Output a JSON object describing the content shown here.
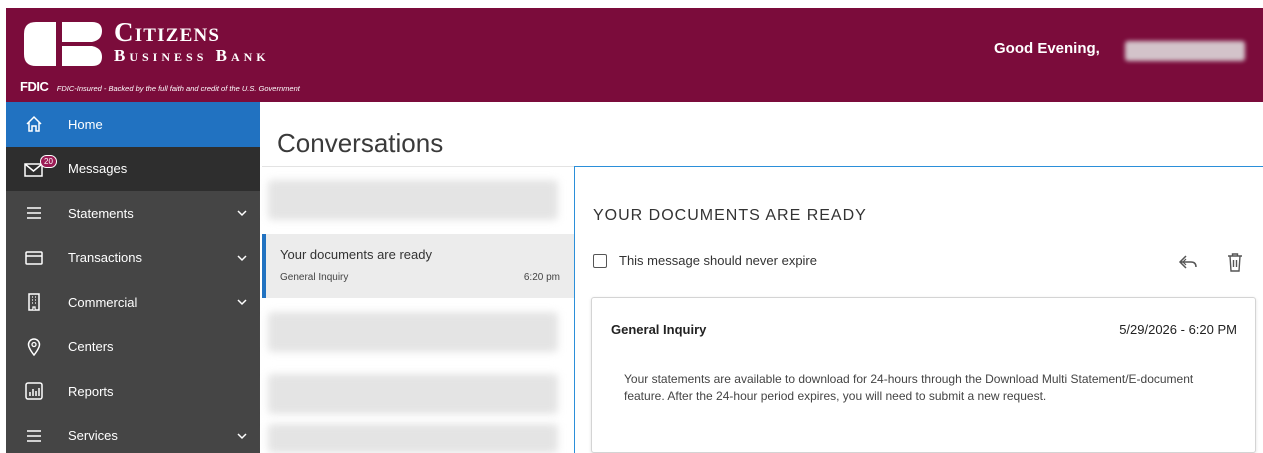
{
  "header": {
    "logo": {
      "line1": "Citizens",
      "line2": "Business Bank"
    },
    "fdic": {
      "logo": "FDIC",
      "text": "FDIC-Insured - Backed by the full faith and credit of the U.S. Government"
    },
    "greeting": "Good Evening,",
    "background_color": "#7b0c3b"
  },
  "sidebar": {
    "items": [
      {
        "label": "Home",
        "icon": "home-icon",
        "active": true
      },
      {
        "label": "Messages",
        "icon": "mail-icon",
        "badge": "20"
      },
      {
        "label": "Statements",
        "icon": "menu-icon",
        "expandable": true
      },
      {
        "label": "Transactions",
        "icon": "card-icon",
        "expandable": true
      },
      {
        "label": "Commercial",
        "icon": "building-icon",
        "expandable": true
      },
      {
        "label": "Centers",
        "icon": "location-pin-icon"
      },
      {
        "label": "Reports",
        "icon": "bar-chart-icon"
      },
      {
        "label": "Services",
        "icon": "menu-icon",
        "expandable": true
      }
    ],
    "active_color": "#2172c1"
  },
  "conversations": {
    "title": "Conversations",
    "selected": {
      "title": "Your documents are ready",
      "category": "General Inquiry",
      "time": "6:20 pm"
    }
  },
  "message": {
    "subject": "YOUR DOCUMENTS ARE READY",
    "expire_label": "This message should never expire",
    "card": {
      "subject": "General Inquiry",
      "date": "5/29/2026 - 6:20 PM",
      "body": "Your statements are available to download for 24-hours through the Download Multi Statement/E-document feature. After the 24-hour period expires, you will need to submit a new request."
    }
  }
}
